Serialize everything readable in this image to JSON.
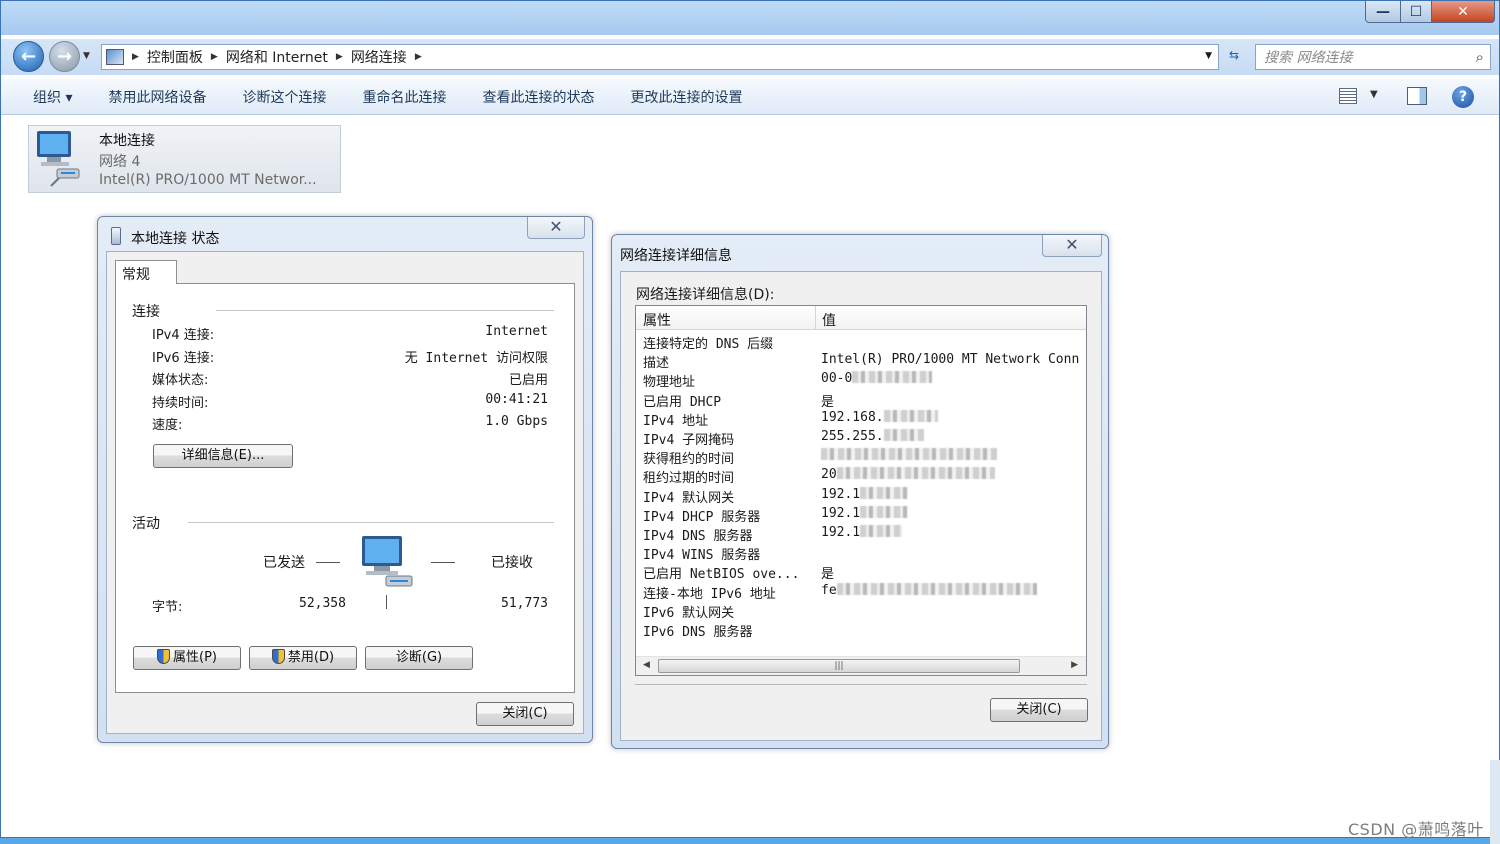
{
  "window": {
    "min_glyph": "—",
    "max_glyph": "☐",
    "close_glyph": "✕"
  },
  "navbar": {
    "breadcrumb": [
      "控制面板",
      "网络和 Internet",
      "网络连接"
    ],
    "search_placeholder": "搜索 网络连接"
  },
  "toolbar": {
    "organize": "组织 ▾",
    "items": [
      "禁用此网络设备",
      "诊断这个连接",
      "重命名此连接",
      "查看此连接的状态",
      "更改此连接的设置"
    ]
  },
  "connection_tile": {
    "name": "本地连接",
    "network": "网络  4",
    "adapter": "Intel(R) PRO/1000 MT Networ..."
  },
  "status_dialog": {
    "title": "本地连接 状态",
    "tab": "常规",
    "connection_group": "连接",
    "rows": [
      {
        "label": "IPv4 连接:",
        "value": "Internet"
      },
      {
        "label": "IPv6 连接:",
        "value": "无 Internet 访问权限"
      },
      {
        "label": "媒体状态:",
        "value": "已启用"
      },
      {
        "label": "持续时间:",
        "value": "00:41:21"
      },
      {
        "label": "速度:",
        "value": "1.0 Gbps"
      }
    ],
    "details_button": "详细信息(E)...",
    "activity_group": "活动",
    "sent_label": "已发送",
    "received_label": "已接收",
    "bytes_label": "字节:",
    "bytes_sent": "52,358",
    "bytes_received": "51,773",
    "properties_button": "属性(P)",
    "disable_button": "禁用(D)",
    "diagnose_button": "诊断(G)",
    "close_button": "关闭(C)"
  },
  "details_dialog": {
    "title": "网络连接详细信息",
    "list_label": "网络连接详细信息(D):",
    "col_property": "属性",
    "col_value": "值",
    "rows": [
      {
        "name": "连接特定的 DNS 后缀",
        "value": "",
        "blur": 0
      },
      {
        "name": "描述",
        "value": "Intel(R) PRO/1000 MT Network Conn",
        "blur": 0
      },
      {
        "name": "物理地址",
        "value": "00-0",
        "blur": 80
      },
      {
        "name": "已启用 DHCP",
        "value": "是",
        "blur": 0
      },
      {
        "name": "IPv4 地址",
        "value": "192.168.",
        "blur": 54
      },
      {
        "name": "IPv4 子网掩码",
        "value": "255.255.",
        "blur": 40
      },
      {
        "name": "获得租约的时间",
        "value": "",
        "blur": 176
      },
      {
        "name": "租约过期的时间",
        "value": "20",
        "blur": 158
      },
      {
        "name": "IPv4 默认网关",
        "value": "192.1",
        "blur": 48
      },
      {
        "name": "IPv4 DHCP 服务器",
        "value": "192.1",
        "blur": 48
      },
      {
        "name": "IPv4 DNS 服务器",
        "value": "192.1",
        "blur": 42
      },
      {
        "name": "IPv4 WINS 服务器",
        "value": "",
        "blur": 0
      },
      {
        "name": "已启用 NetBIOS ove...",
        "value": "是",
        "blur": 0
      },
      {
        "name": "连接-本地 IPv6 地址",
        "value": "fe",
        "blur": 200
      },
      {
        "name": "IPv6 默认网关",
        "value": "",
        "blur": 0
      },
      {
        "name": "IPv6 DNS 服务器",
        "value": "",
        "blur": 0
      }
    ],
    "scroll_thumb_glyph": "|||",
    "close_button": "关闭(C)"
  },
  "watermark": "CSDN @萧鸣落叶"
}
